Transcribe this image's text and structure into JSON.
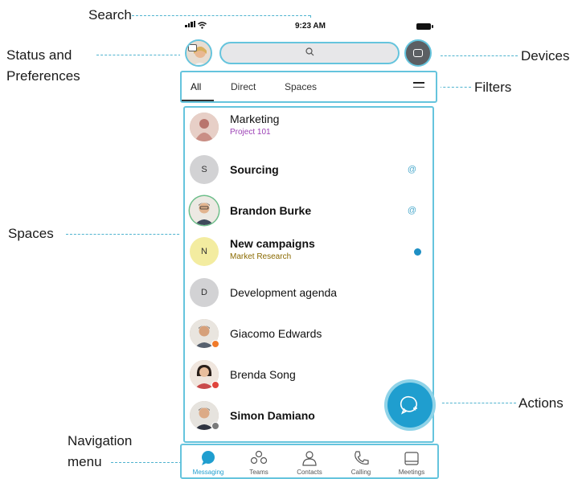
{
  "callouts": {
    "search": "Search",
    "status_line1": "Status and",
    "status_line2": "Preferences",
    "devices": "Devices",
    "filters": "Filters",
    "spaces": "Spaces",
    "actions": "Actions",
    "nav_line1": "Navigation",
    "nav_line2": "menu"
  },
  "status_bar": {
    "time": "9:23 AM"
  },
  "header": {
    "avatar_icon": "user-photo",
    "search_icon": "search-icon",
    "devices_icon": "devices-icon"
  },
  "filters": {
    "tabs": [
      "All",
      "Direct",
      "Spaces"
    ],
    "active_tab": "All",
    "filter_icon": "sliders-icon"
  },
  "spaces": [
    {
      "name": "Marketing",
      "subtitle": "Project 101",
      "subtitle_color": "#9b3fb5",
      "avatar": "photo",
      "bold": false
    },
    {
      "name": "Sourcing",
      "initial": "S",
      "avatar": "initial",
      "bold": true,
      "indicator": "mention"
    },
    {
      "name": "Brandon Burke",
      "avatar": "photo",
      "bold": true,
      "indicator": "mention"
    },
    {
      "name": "New campaigns",
      "subtitle": "Market Research",
      "subtitle_color": "#8a6a00",
      "initial": "N",
      "avatar": "initial-yellow",
      "bold": true,
      "indicator": "unread"
    },
    {
      "name": "Development agenda",
      "initial": "D",
      "avatar": "initial",
      "bold": false
    },
    {
      "name": "Giacomo Edwards",
      "avatar": "photo",
      "bold": false,
      "presence": "#f07a2a"
    },
    {
      "name": "Brenda Song",
      "avatar": "photo",
      "bold": false,
      "presence": "#e0443c"
    },
    {
      "name": "Simon Damiano",
      "avatar": "photo",
      "bold": true,
      "presence": "#7a7a7a"
    }
  ],
  "fab": {
    "icon": "new-message-icon"
  },
  "nav": [
    {
      "label": "Messaging",
      "icon": "messaging-icon",
      "active": true
    },
    {
      "label": "Teams",
      "icon": "teams-icon",
      "active": false
    },
    {
      "label": "Contacts",
      "icon": "contacts-icon",
      "active": false
    },
    {
      "label": "Calling",
      "icon": "phone-icon",
      "active": false
    },
    {
      "label": "Meetings",
      "icon": "calendar-icon",
      "active": false
    }
  ],
  "colors": {
    "accent": "#1f9ecf",
    "callout_line": "#4fb3cf",
    "highlight_border": "#65c4dd"
  }
}
